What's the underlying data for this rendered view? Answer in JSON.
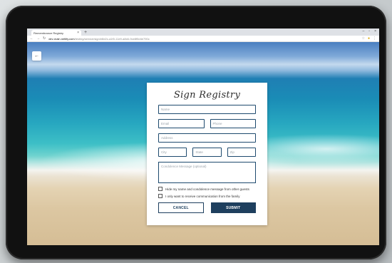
{
  "browser": {
    "tab_title": "Remembrance Registry",
    "tab_close": "×",
    "new_tab": "+",
    "window_controls": [
      "–",
      "▫",
      "×"
    ],
    "back": "←",
    "forward": "→",
    "reload": "↻",
    "lock": "🔒",
    "url_host": "dev-main.netlify.com",
    "url_path": "/testing/service/sign/e8d2c-a1f0-11e9-a8d4-9ce8f5d4e790c",
    "star": "☆",
    "menu": "⋮"
  },
  "page": {
    "back_button": "←"
  },
  "form": {
    "title": "Sign Registry",
    "name_placeholder": "Name",
    "email_placeholder": "Email",
    "phone_placeholder": "Phone",
    "address_placeholder": "Address",
    "city_placeholder": "City",
    "state_placeholder": "State",
    "zip_placeholder": "Zip",
    "message_placeholder": "Condolence Message (optional)",
    "hide_label": "Hide my name and condolence message from other guests",
    "family_label": "I only want to receive communication from the family",
    "cancel_label": "CANCEL",
    "submit_label": "SUBMIT"
  },
  "colors": {
    "primary": "#1e3f5e",
    "field_border": "#1e4a6e"
  }
}
